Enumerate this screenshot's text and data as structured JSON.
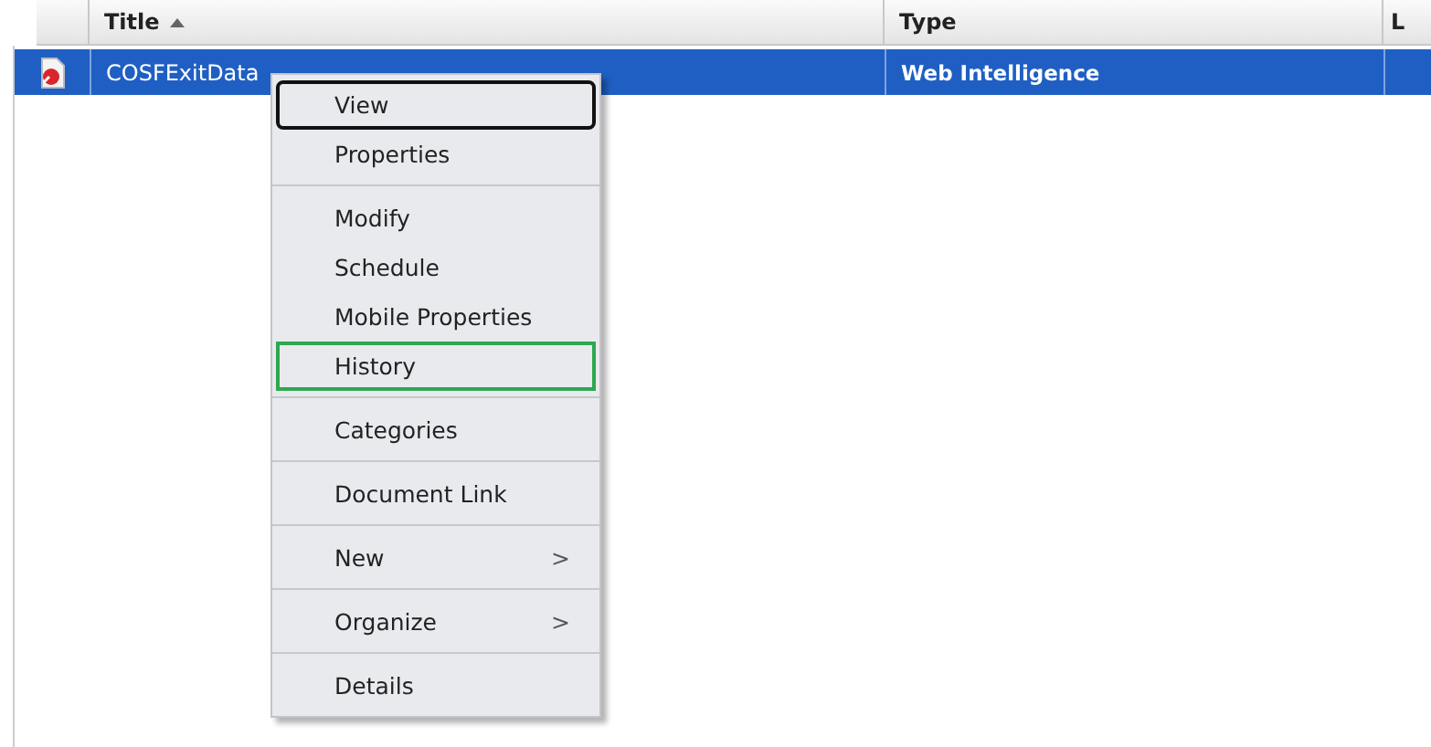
{
  "table": {
    "columns": [
      {
        "label": "Title",
        "sorted": true
      },
      {
        "label": "Type",
        "sorted": false
      },
      {
        "label": "L",
        "sorted": false
      }
    ],
    "rows": [
      {
        "title": "COSFExitData",
        "type": "Web Intelligence",
        "selected": true
      }
    ]
  },
  "context_menu": {
    "groups": [
      [
        {
          "label": "View",
          "color": "#111111"
        },
        {
          "label": "Properties"
        }
      ],
      [
        {
          "label": "Modify"
        },
        {
          "label": "Schedule"
        },
        {
          "label": "Mobile Properties"
        },
        {
          "label": "History",
          "color": "#2ea84f"
        }
      ],
      [
        {
          "label": "Categories"
        }
      ],
      [
        {
          "label": "Document Link"
        }
      ],
      [
        {
          "label": "New",
          "arrow": ">"
        }
      ],
      [
        {
          "label": "Organize",
          "arrow": ">"
        }
      ],
      [
        {
          "label": "Details"
        }
      ]
    ]
  }
}
